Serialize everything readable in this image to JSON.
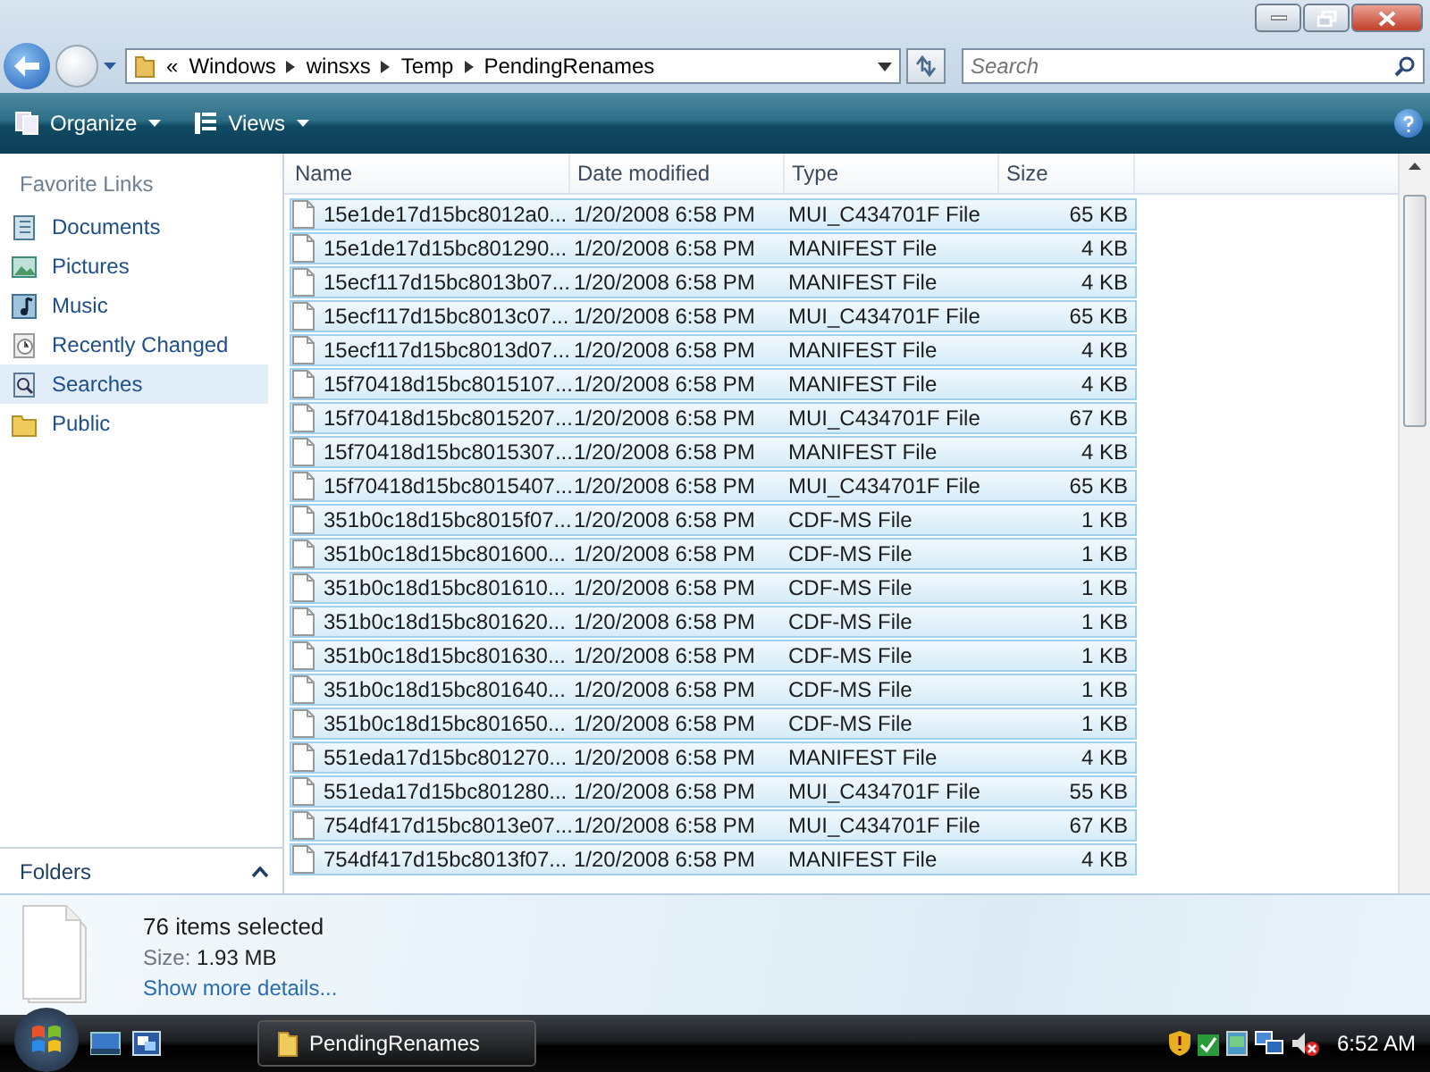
{
  "address_bar": {
    "overflow": "«",
    "segments": [
      "Windows",
      "winsxs",
      "Temp",
      "PendingRenames"
    ]
  },
  "search": {
    "placeholder": "Search"
  },
  "toolbar": {
    "buttons": [
      {
        "label": "Organize",
        "kind": "organize"
      },
      {
        "label": "Views",
        "kind": "views"
      }
    ]
  },
  "sidebar": {
    "heading": "Favorite Links",
    "items": [
      {
        "label": "Documents",
        "kind": "documents",
        "selected": false
      },
      {
        "label": "Pictures",
        "kind": "pictures",
        "selected": false
      },
      {
        "label": "Music",
        "kind": "music",
        "selected": false
      },
      {
        "label": "Recently Changed",
        "kind": "recent",
        "selected": false
      },
      {
        "label": "Searches",
        "kind": "searches",
        "selected": true
      },
      {
        "label": "Public",
        "kind": "folder",
        "selected": false
      }
    ],
    "folders_label": "Folders"
  },
  "file_list": {
    "columns": [
      "Name",
      "Date modified",
      "Type",
      "Size"
    ],
    "rows": [
      {
        "name": "15e1de17d15bc8012a0...",
        "date": "1/20/2008 6:58 PM",
        "type": "MUI_C434701F File",
        "size": "65 KB",
        "selected": true
      },
      {
        "name": "15e1de17d15bc801290...",
        "date": "1/20/2008 6:58 PM",
        "type": "MANIFEST File",
        "size": "4 KB",
        "selected": true
      },
      {
        "name": "15ecf117d15bc8013b07...",
        "date": "1/20/2008 6:58 PM",
        "type": "MANIFEST File",
        "size": "4 KB",
        "selected": true
      },
      {
        "name": "15ecf117d15bc8013c07...",
        "date": "1/20/2008 6:58 PM",
        "type": "MUI_C434701F File",
        "size": "65 KB",
        "selected": true
      },
      {
        "name": "15ecf117d15bc8013d07...",
        "date": "1/20/2008 6:58 PM",
        "type": "MANIFEST File",
        "size": "4 KB",
        "selected": true
      },
      {
        "name": "15f70418d15bc8015107...",
        "date": "1/20/2008 6:58 PM",
        "type": "MANIFEST File",
        "size": "4 KB",
        "selected": true
      },
      {
        "name": "15f70418d15bc8015207...",
        "date": "1/20/2008 6:58 PM",
        "type": "MUI_C434701F File",
        "size": "67 KB",
        "selected": true
      },
      {
        "name": "15f70418d15bc8015307...",
        "date": "1/20/2008 6:58 PM",
        "type": "MANIFEST File",
        "size": "4 KB",
        "selected": true
      },
      {
        "name": "15f70418d15bc8015407...",
        "date": "1/20/2008 6:58 PM",
        "type": "MUI_C434701F File",
        "size": "65 KB",
        "selected": true
      },
      {
        "name": "351b0c18d15bc8015f07...",
        "date": "1/20/2008 6:58 PM",
        "type": "CDF-MS File",
        "size": "1 KB",
        "selected": true
      },
      {
        "name": "351b0c18d15bc801600...",
        "date": "1/20/2008 6:58 PM",
        "type": "CDF-MS File",
        "size": "1 KB",
        "selected": true
      },
      {
        "name": "351b0c18d15bc801610...",
        "date": "1/20/2008 6:58 PM",
        "type": "CDF-MS File",
        "size": "1 KB",
        "selected": true
      },
      {
        "name": "351b0c18d15bc801620...",
        "date": "1/20/2008 6:58 PM",
        "type": "CDF-MS File",
        "size": "1 KB",
        "selected": true
      },
      {
        "name": "351b0c18d15bc801630...",
        "date": "1/20/2008 6:58 PM",
        "type": "CDF-MS File",
        "size": "1 KB",
        "selected": true
      },
      {
        "name": "351b0c18d15bc801640...",
        "date": "1/20/2008 6:58 PM",
        "type": "CDF-MS File",
        "size": "1 KB",
        "selected": true
      },
      {
        "name": "351b0c18d15bc801650...",
        "date": "1/20/2008 6:58 PM",
        "type": "CDF-MS File",
        "size": "1 KB",
        "selected": true
      },
      {
        "name": "551eda17d15bc801270...",
        "date": "1/20/2008 6:58 PM",
        "type": "MANIFEST File",
        "size": "4 KB",
        "selected": true
      },
      {
        "name": "551eda17d15bc801280...",
        "date": "1/20/2008 6:58 PM",
        "type": "MUI_C434701F File",
        "size": "55 KB",
        "selected": true
      },
      {
        "name": "754df417d15bc8013e07...",
        "date": "1/20/2008 6:58 PM",
        "type": "MUI_C434701F File",
        "size": "67 KB",
        "selected": true
      },
      {
        "name": "754df417d15bc8013f07...",
        "date": "1/20/2008 6:58 PM",
        "type": "MANIFEST File",
        "size": "4 KB",
        "selected": true
      }
    ]
  },
  "details": {
    "title": "76 items selected",
    "size_label": "Size:",
    "size_value": "1.93 MB",
    "link": "Show more details..."
  },
  "taskbar": {
    "tasks": [
      {
        "label": "PendingRenames"
      }
    ],
    "clock": "6:52 AM"
  }
}
